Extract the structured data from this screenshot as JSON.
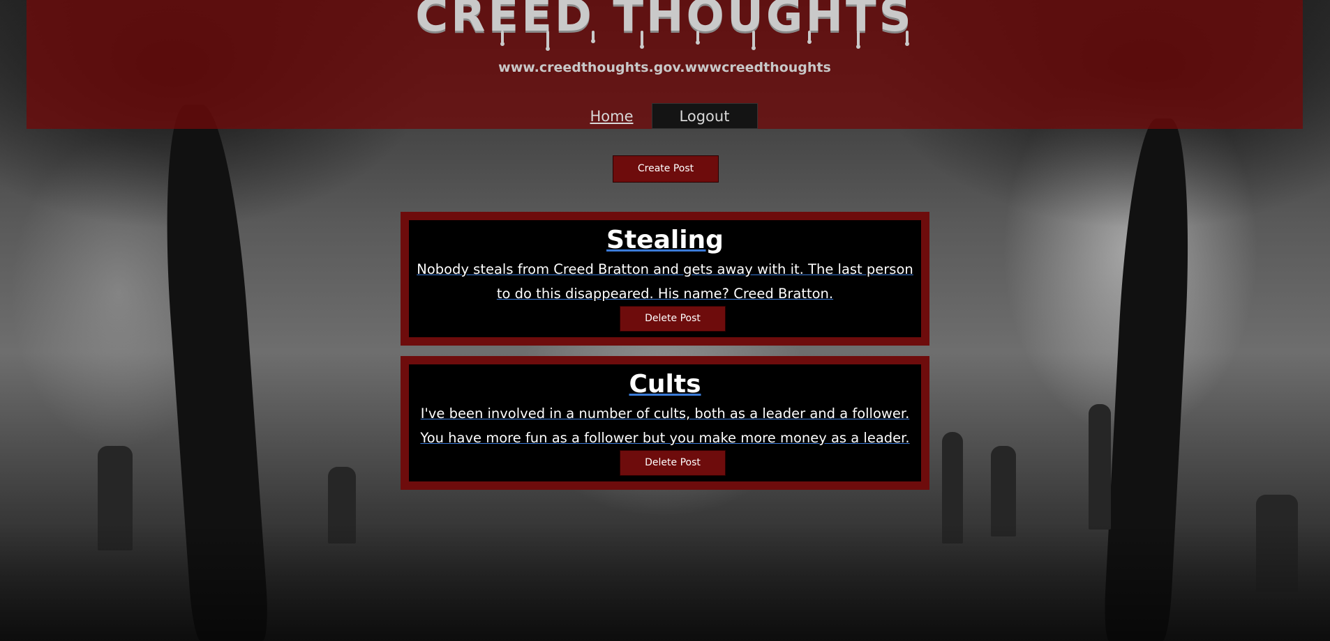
{
  "header": {
    "title": "CREED THOUGHTS",
    "url": "www.creedthoughts.gov.wwwcreedthoughts"
  },
  "nav": {
    "home": "Home",
    "logout": "Logout"
  },
  "actions": {
    "create_post": "Create Post"
  },
  "posts": [
    {
      "title": "Stealing",
      "body": "Nobody steals from Creed Bratton and gets away with it. The last person to do this disappeared. His name? Creed Bratton.",
      "delete_label": "Delete Post"
    },
    {
      "title": "Cults",
      "body": "I've been involved in a number of cults, both as a leader and a follower. You have more fun as a follower but you make more money as a leader.",
      "delete_label": "Delete Post"
    }
  ],
  "colors": {
    "accent": "#6e0c0c",
    "header_bg": "#6e0a0a",
    "link_underline": "#3b7bd8",
    "post_bg": "#000000"
  }
}
